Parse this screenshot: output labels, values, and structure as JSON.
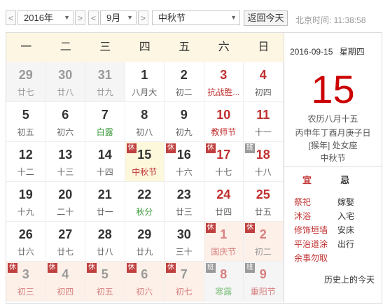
{
  "toolbar": {
    "prev_year": "<",
    "year": "2016年",
    "next_year": ">",
    "prev_month": "<",
    "month": "9月",
    "next_month": ">",
    "holiday": "中秋节",
    "today_button": "返回今天",
    "beijing_time": "北京时间: 11:38:58",
    "dropdown_caret": "▼"
  },
  "weekdays": [
    "一",
    "二",
    "三",
    "四",
    "五",
    "六",
    "日"
  ],
  "days": [
    {
      "n": "29",
      "s": "廿七",
      "other": true
    },
    {
      "n": "30",
      "s": "廿八",
      "other": true
    },
    {
      "n": "31",
      "s": "廿九",
      "other": true
    },
    {
      "n": "1",
      "s": "八月大"
    },
    {
      "n": "2",
      "s": "初二"
    },
    {
      "n": "3",
      "s": "抗战胜...",
      "red": true,
      "sred": true
    },
    {
      "n": "4",
      "s": "初四",
      "red": true
    },
    {
      "n": "5",
      "s": "初五"
    },
    {
      "n": "6",
      "s": "初六"
    },
    {
      "n": "7",
      "s": "白露",
      "sgreen": true
    },
    {
      "n": "8",
      "s": "初八"
    },
    {
      "n": "9",
      "s": "初九"
    },
    {
      "n": "10",
      "s": "教师节",
      "red": true,
      "sred": true
    },
    {
      "n": "11",
      "s": "十一",
      "red": true
    },
    {
      "n": "12",
      "s": "十二"
    },
    {
      "n": "13",
      "s": "十三"
    },
    {
      "n": "14",
      "s": "十四"
    },
    {
      "n": "15",
      "s": "中秋节",
      "tag": "休",
      "selected": true,
      "sred": true
    },
    {
      "n": "16",
      "s": "十六",
      "tag": "休",
      "sred": false
    },
    {
      "n": "17",
      "s": "十七",
      "tag": "休",
      "red": true
    },
    {
      "n": "18",
      "s": "十八",
      "tag": "班",
      "tagtype": "ban",
      "red": true
    },
    {
      "n": "19",
      "s": "十九"
    },
    {
      "n": "20",
      "s": "二十"
    },
    {
      "n": "21",
      "s": "廿一"
    },
    {
      "n": "22",
      "s": "秋分",
      "sgreen": true
    },
    {
      "n": "23",
      "s": "廿三"
    },
    {
      "n": "24",
      "s": "廿四",
      "red": true
    },
    {
      "n": "25",
      "s": "廿五",
      "red": true
    },
    {
      "n": "26",
      "s": "廿六"
    },
    {
      "n": "27",
      "s": "廿七"
    },
    {
      "n": "28",
      "s": "廿八"
    },
    {
      "n": "29",
      "s": "廿九"
    },
    {
      "n": "30",
      "s": "三十"
    },
    {
      "n": "1",
      "s": "国庆节",
      "other": true,
      "holiday": true,
      "tag": "休",
      "red": true,
      "sred": true
    },
    {
      "n": "2",
      "s": "初二",
      "other": true,
      "holiday": true,
      "tag": "休",
      "red": true
    },
    {
      "n": "3",
      "s": "初三",
      "other": true,
      "holiday": true,
      "tag": "休",
      "sred": true
    },
    {
      "n": "4",
      "s": "初四",
      "other": true,
      "holiday": true,
      "tag": "休",
      "sred": true
    },
    {
      "n": "5",
      "s": "初五",
      "other": true,
      "holiday": true,
      "tag": "休",
      "sred": true
    },
    {
      "n": "6",
      "s": "初六",
      "other": true,
      "holiday": true,
      "tag": "休",
      "sred": true
    },
    {
      "n": "7",
      "s": "初七",
      "other": true,
      "holiday": true,
      "tag": "休",
      "sred": true
    },
    {
      "n": "8",
      "s": "寒露",
      "other": true,
      "tag": "班",
      "tagtype": "ban",
      "red": true,
      "sgreen": true
    },
    {
      "n": "9",
      "s": "重阳节",
      "other": true,
      "tag": "班",
      "tagtype": "ban",
      "red": true,
      "sred": true
    }
  ],
  "side": {
    "date": "2016-09-15",
    "weekday": "星期四",
    "big_day": "15",
    "lunar": "农历八月十五",
    "ganzhi": "丙申年丁酉月庚子日",
    "zodiac": "[猴年] 处女座",
    "festival": "中秋节",
    "yi_label": "宜",
    "ji_label": "忌",
    "yi_items": [
      "祭祀",
      "沐浴",
      "修饰垣墙",
      "平治道涂",
      "余事勿取"
    ],
    "ji_items": [
      "嫁娶",
      "入宅",
      "安床",
      "出行"
    ],
    "history": "历史上的今天"
  }
}
